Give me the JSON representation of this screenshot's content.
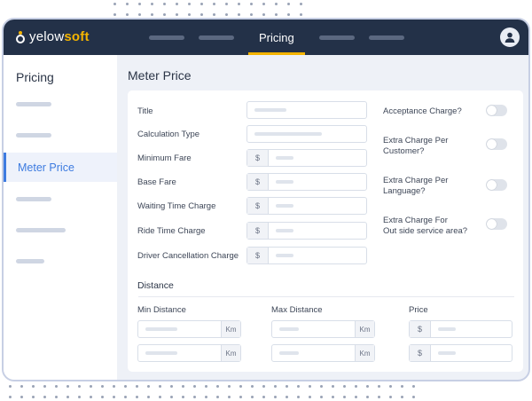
{
  "app": {
    "logo_prefix": "yelow",
    "logo_accent": "soft",
    "brand_color": "#f4b400",
    "header_color": "#233148"
  },
  "nav": {
    "active_tab": "Pricing"
  },
  "sidebar": {
    "title": "Pricing",
    "active_item": "Meter Price"
  },
  "main": {
    "title": "Meter Price"
  },
  "form": {
    "title_label": "Title",
    "calc_type_label": "Calculation Type",
    "min_fare_label": "Minimum Fare",
    "base_fare_label": "Base Fare",
    "waiting_label": "Waiting Time Charge",
    "ride_time_label": "Ride Time Charge",
    "cancel_label": "Driver Cancellation Charge",
    "currency": "$"
  },
  "toggles": {
    "acceptance_label": "Acceptance Charge?",
    "per_customer_1": "Extra Charge Per",
    "per_customer_2": "Customer?",
    "per_language_1": "Extra Charge Per",
    "per_language_2": "Language?",
    "outside_1": "Extra Charge For",
    "outside_2": "Out side service area?"
  },
  "distance": {
    "section_title": "Distance",
    "min_label": "Min Distance",
    "max_label": "Max Distance",
    "price_label": "Price",
    "unit": "Km",
    "currency": "$"
  }
}
